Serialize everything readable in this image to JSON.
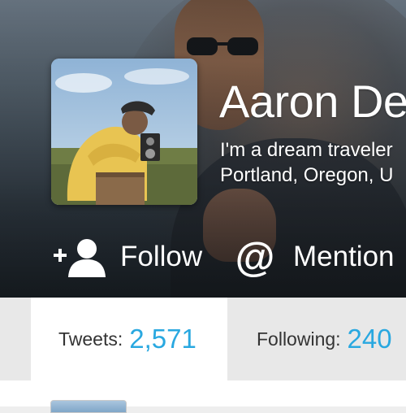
{
  "profile": {
    "name": "Aaron De",
    "bio_line1": "I'm a dream traveler",
    "bio_line2": "Portland, Oregon, U"
  },
  "actions": {
    "follow_label": "Follow",
    "mention_label": "Mention",
    "mention_symbol": "@"
  },
  "stats": {
    "tweets_label": "Tweets:",
    "tweets_value": "2,571",
    "following_label": "Following:",
    "following_value": "240"
  },
  "colors": {
    "accent": "#29a8e0",
    "hero_dark": "#2f3942"
  },
  "icons": [
    "add-user-icon",
    "at-sign-icon"
  ]
}
